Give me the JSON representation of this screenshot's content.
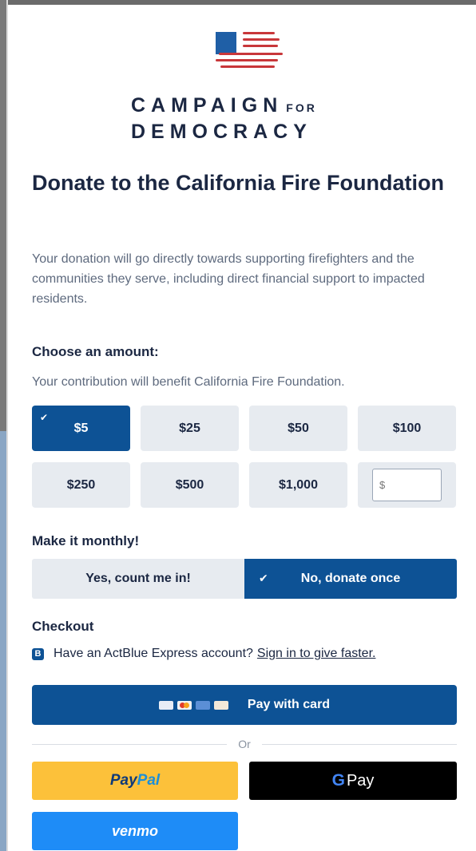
{
  "brand": {
    "line1": "CAMPAIGN",
    "line1_suffix": "FOR",
    "line2": "DEMOCRACY",
    "flag_icon": "flag-logo-icon",
    "colors": {
      "blue": "#1f5fa6",
      "red": "#c8373a"
    }
  },
  "title": "Donate to the California Fire Foundation",
  "description": "Your donation will go directly towards supporting firefighters and the communities they serve, including direct financial support to impacted residents.",
  "amount": {
    "heading": "Choose an amount:",
    "subtext": "Your contribution will benefit California Fire Foundation.",
    "options": [
      "$5",
      "$25",
      "$50",
      "$100",
      "$250",
      "$500",
      "$1,000"
    ],
    "selected": "$5",
    "other_placeholder": "$"
  },
  "monthly": {
    "heading": "Make it monthly!",
    "yes_label": "Yes, count me in!",
    "no_label": "No, donate once",
    "selected": "No, donate once"
  },
  "checkout": {
    "heading": "Checkout",
    "express_text": "Have an ActBlue Express account?",
    "express_link": "Sign in to give faster.",
    "express_icon_letter": "B",
    "pay_card_label": "Pay with card",
    "or_label": "Or",
    "paypal_part1": "Pay",
    "paypal_part2": "Pal",
    "gpay_g": "G",
    "gpay_label": "Pay",
    "venmo_label": "venmo"
  },
  "colors": {
    "primary": "#0d5295",
    "button_gray": "#e7ebf0",
    "paypal": "#fcc13a",
    "gpay": "#000000",
    "venmo": "#1e8cf7"
  }
}
